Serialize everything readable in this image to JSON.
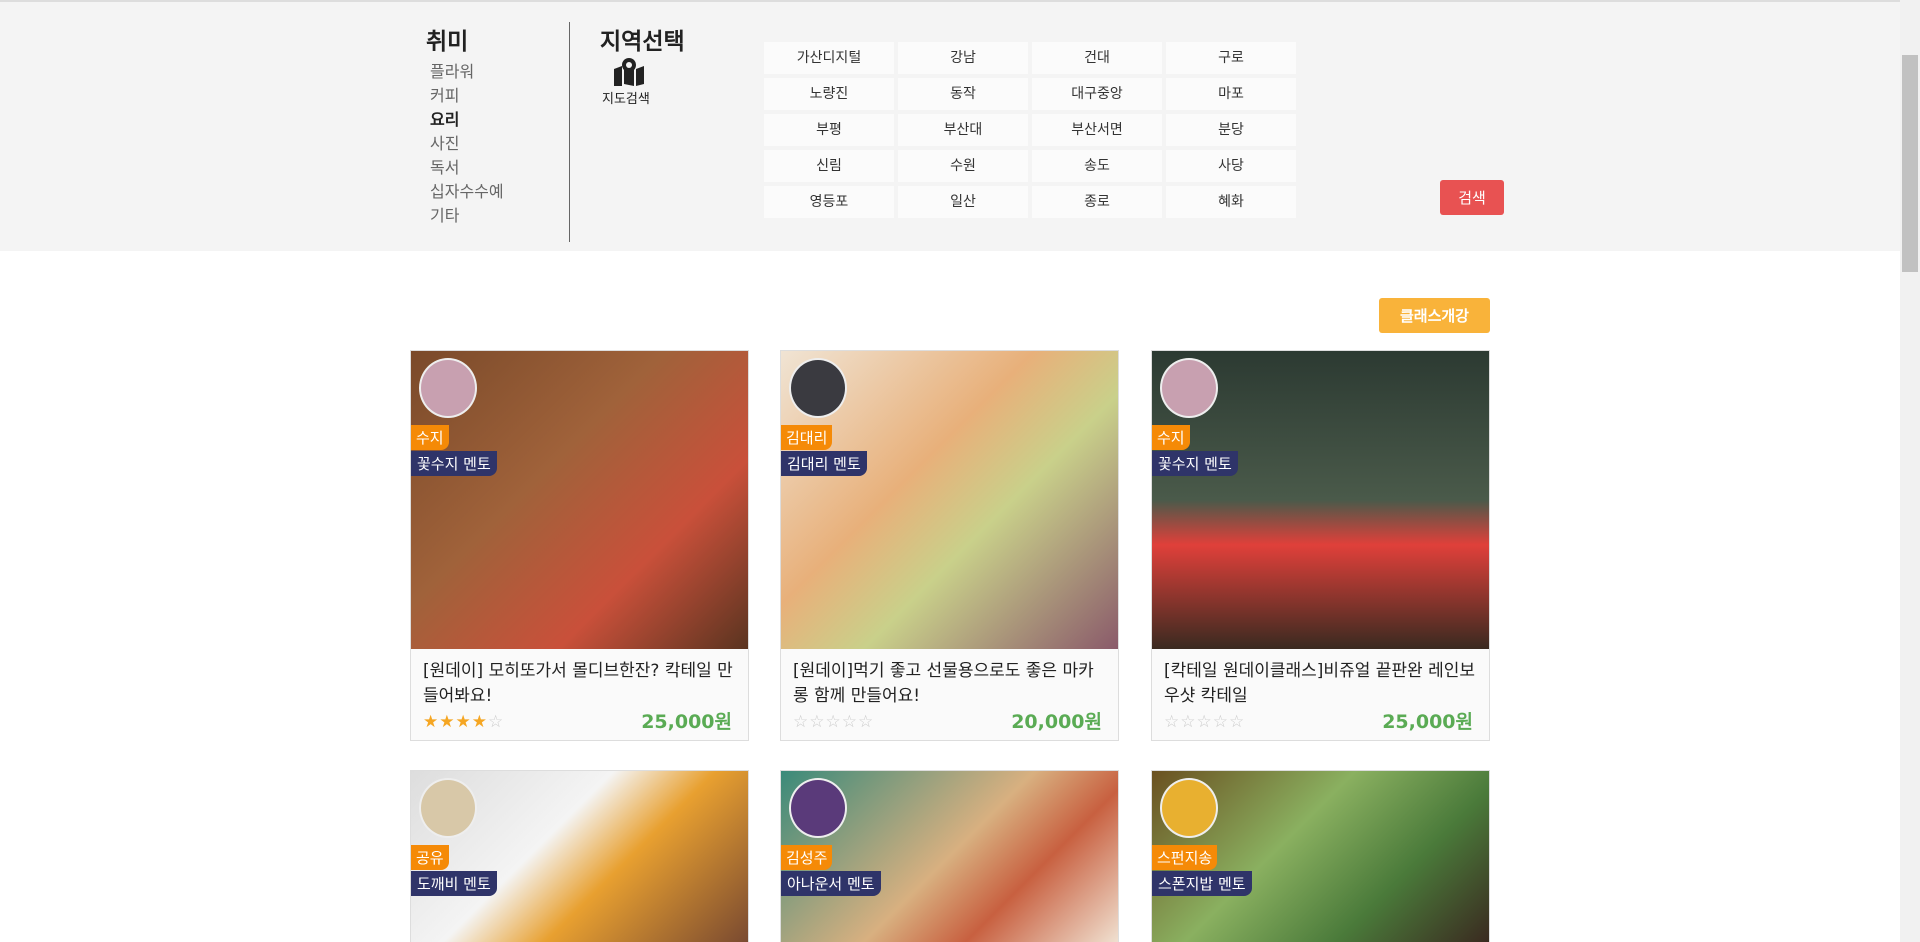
{
  "hobby": {
    "title": "취미",
    "items": [
      "플라워",
      "커피",
      "요리",
      "사진",
      "독서",
      "십자수수예",
      "기타"
    ],
    "active": "요리"
  },
  "region": {
    "title": "지역선택",
    "map_label": "지도검색",
    "items": [
      "가산디지털",
      "강남",
      "건대",
      "구로",
      "노량진",
      "동작",
      "대구중앙",
      "마포",
      "부평",
      "부산대",
      "부산서면",
      "분당",
      "신림",
      "수원",
      "송도",
      "사당",
      "영등포",
      "일산",
      "종로",
      "혜화"
    ]
  },
  "search_label": "검색",
  "open_class_label": "클래스개강",
  "colors": {
    "search": "#e85252",
    "open": "#f9b33a",
    "name_badge": "#f58a07",
    "mentor_badge": "#2f3469",
    "price": "#5aab54"
  },
  "cards": [
    {
      "name": "수지",
      "mentor": "꽃수지 멘토",
      "title": "[원데이] 모히또가서 몰디브한잔? 칵테일 만들어봐요!",
      "rating": 4,
      "price": "25,000원"
    },
    {
      "name": "김대리",
      "mentor": "김대리 멘토",
      "title": "[원데이]먹기 좋고 선물용으로도 좋은 마카롱 함께 만들어요!",
      "rating": 0,
      "price": "20,000원"
    },
    {
      "name": "수지",
      "mentor": "꽃수지 멘토",
      "title": "[칵테일 원데이클래스]비쥬얼 끝판완 레인보우샷 칵테일",
      "rating": 0,
      "price": "25,000원"
    },
    {
      "name": "공유",
      "mentor": "도깨비 멘토"
    },
    {
      "name": "김성주",
      "mentor": "아나운서 멘토"
    },
    {
      "name": "스펀지송",
      "mentor": "스폰지밥 멘토"
    }
  ]
}
